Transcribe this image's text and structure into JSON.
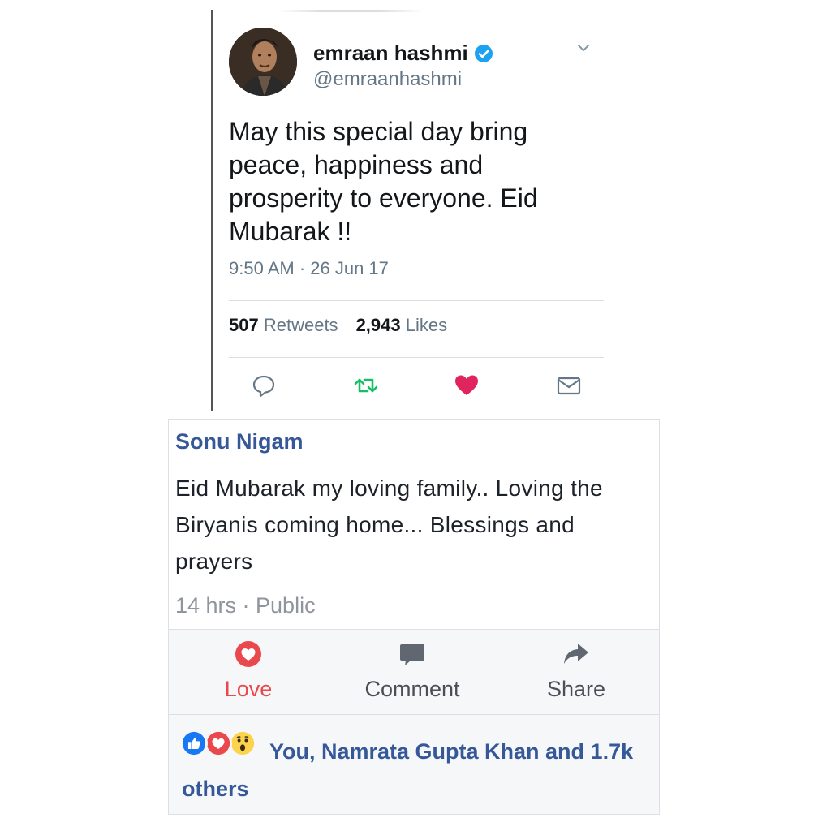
{
  "tweet": {
    "display_name": "emraan hashmi",
    "handle": "@emraanhashmi",
    "text": "May this special day bring peace, happiness and prosperity to everyone. Eid Mubarak !!",
    "timestamp": "9:50 AM · 26 Jun 17",
    "retweets_count": "507",
    "retweets_label": "Retweets",
    "likes_count": "2,943",
    "likes_label": "Likes",
    "icons": [
      "verified-badge",
      "chevron-down",
      "reply",
      "retweet",
      "heart",
      "direct-message"
    ],
    "colors": {
      "verified": "#1da1f2",
      "retweet": "#17bf63",
      "heart": "#e0245e",
      "text": "#14171a",
      "muted": "#657786"
    }
  },
  "facebook": {
    "author": "Sonu Nigam",
    "text": "Eid Mubarak my loving family.. Loving the Biryanis coming home... Blessings and prayers",
    "meta": "14 hrs · Public",
    "actions": [
      {
        "label": "Love",
        "icon": "love-reaction"
      },
      {
        "label": "Comment",
        "icon": "comment"
      },
      {
        "label": "Share",
        "icon": "share-arrow"
      }
    ],
    "reactions_text": "You, Namrata Gupta Khan and 1.7k others",
    "reaction_icons": [
      "like",
      "love",
      "wow"
    ],
    "colors": {
      "author": "#365899",
      "love": "#e9484d",
      "muted": "#90949c"
    }
  }
}
